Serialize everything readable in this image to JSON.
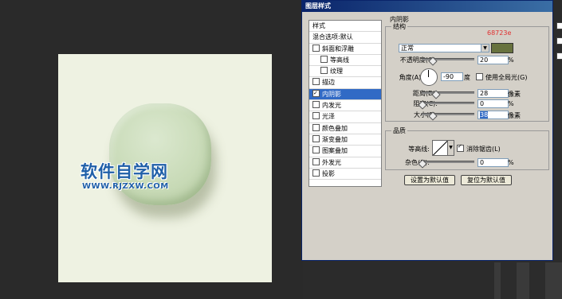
{
  "dialog": {
    "title": "图层样式",
    "annotation": "68723e",
    "color_swatch": "#68723e"
  },
  "styles_list": [
    {
      "label": "样式",
      "type": "header"
    },
    {
      "label": "混合选项:默认",
      "type": "header"
    },
    {
      "label": "斜面和浮雕",
      "checked": false
    },
    {
      "label": "等高线",
      "checked": false,
      "indent": true
    },
    {
      "label": "纹理",
      "checked": false,
      "indent": true
    },
    {
      "label": "描边",
      "checked": false
    },
    {
      "label": "内阴影",
      "checked": true,
      "selected": true
    },
    {
      "label": "内发光",
      "checked": false
    },
    {
      "label": "光泽",
      "checked": false
    },
    {
      "label": "颜色叠加",
      "checked": false
    },
    {
      "label": "渐变叠加",
      "checked": false
    },
    {
      "label": "图案叠加",
      "checked": false
    },
    {
      "label": "外发光",
      "checked": false
    },
    {
      "label": "投影",
      "checked": false
    }
  ],
  "inner_shadow": {
    "section_title": "内阴影",
    "structure_title": "结构",
    "blend_mode_label": "混合模式(B):",
    "blend_mode_value": "正常",
    "opacity_label": "不透明度(O):",
    "opacity_value": "20",
    "angle_label": "角度(A):",
    "angle_value": "-90",
    "angle_unit": "度",
    "global_light_label": "使用全局光(G)",
    "distance_label": "距离(D):",
    "distance_value": "28",
    "choke_label": "阻塞(C):",
    "choke_value": "0",
    "size_label": "大小(S):",
    "size_value": "38",
    "percent": "%",
    "px": "像素",
    "quality_title": "品质",
    "contour_label": "等高线:",
    "antialias_label": "消除锯齿(L)",
    "noise_label": "杂色(N):",
    "noise_value": "0",
    "set_default_button": "设置为默认值",
    "reset_default_button": "复位为默认值"
  },
  "watermark": {
    "main": "软件自学网",
    "sub": "WWW.RJZXW.COM"
  }
}
